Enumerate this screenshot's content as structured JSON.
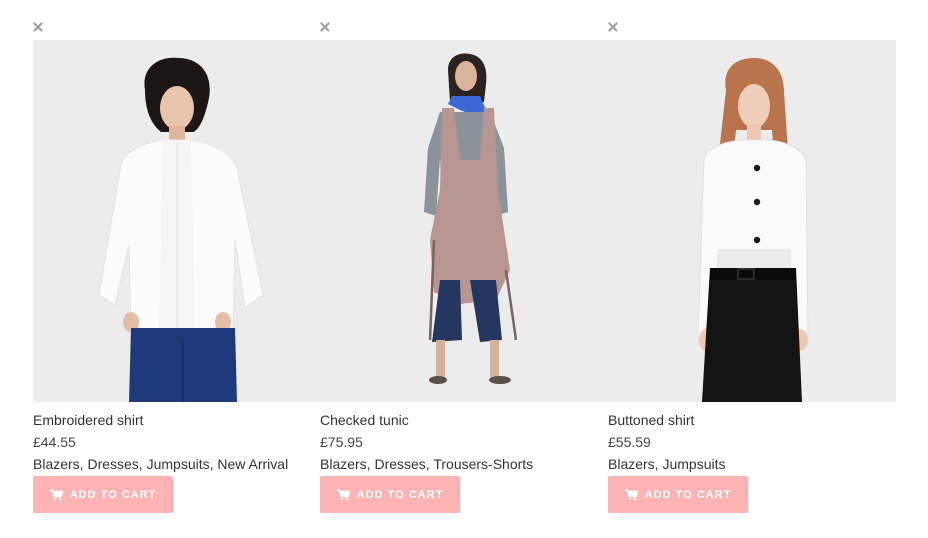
{
  "products": [
    {
      "name": "Embroidered shirt",
      "price": "£44.55",
      "categories": "Blazers, Dresses, Jumpsuits, New Arrival",
      "cart_label": "ADD TO CART",
      "image": "woman-white-embroidered-shirt-photo"
    },
    {
      "name": "Checked tunic",
      "price": "£75.95",
      "categories": "Blazers, Dresses, Trousers-Shorts",
      "cart_label": "ADD TO CART",
      "image": "woman-checked-tunic-photo"
    },
    {
      "name": "Buttoned shirt",
      "price": "£55.59",
      "categories": "Blazers, Jumpsuits",
      "cart_label": "ADD TO CART",
      "image": "woman-white-buttoned-shirt-photo"
    }
  ],
  "icons": {
    "remove": "close-icon",
    "cart": "shopping-cart-icon"
  },
  "colors": {
    "button_bg": "#ffb3b3",
    "button_text": "#ffffff",
    "remove_icon": "#a0a0a0",
    "photo_bg": "#ececec"
  }
}
